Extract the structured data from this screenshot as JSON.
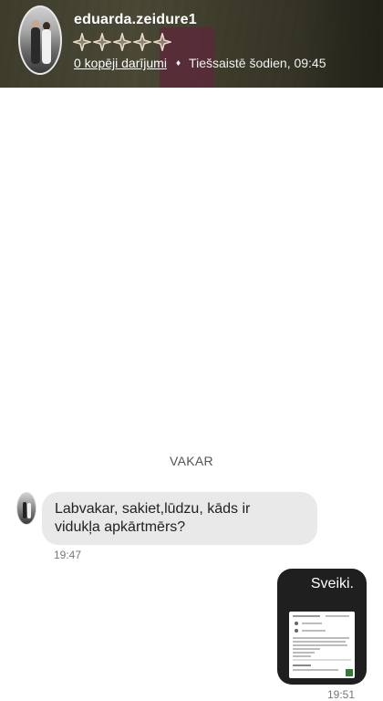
{
  "header": {
    "username": "eduarda.zeidure1",
    "rating_icon": "star-icon",
    "deals_link": "0 kopēji darījumi",
    "separator": "♦",
    "status": "Tiešsaistē šodien, 09:45"
  },
  "chat": {
    "day_label": "VAKAR",
    "incoming": {
      "text_line1": "Labvakar, sakiet,lūdzu, kāds ir",
      "text_line2": "vidukļa apkārtmērs?",
      "time": "19:47"
    },
    "outgoing": {
      "text": "Sveiki.",
      "attachment_icon": "image-thumbnail",
      "time": "19:51"
    }
  },
  "colors": {
    "header_bg": "#4f4c37",
    "incoming_bubble": "#e9e9e9",
    "outgoing_bubble": "#1f1f1f"
  }
}
